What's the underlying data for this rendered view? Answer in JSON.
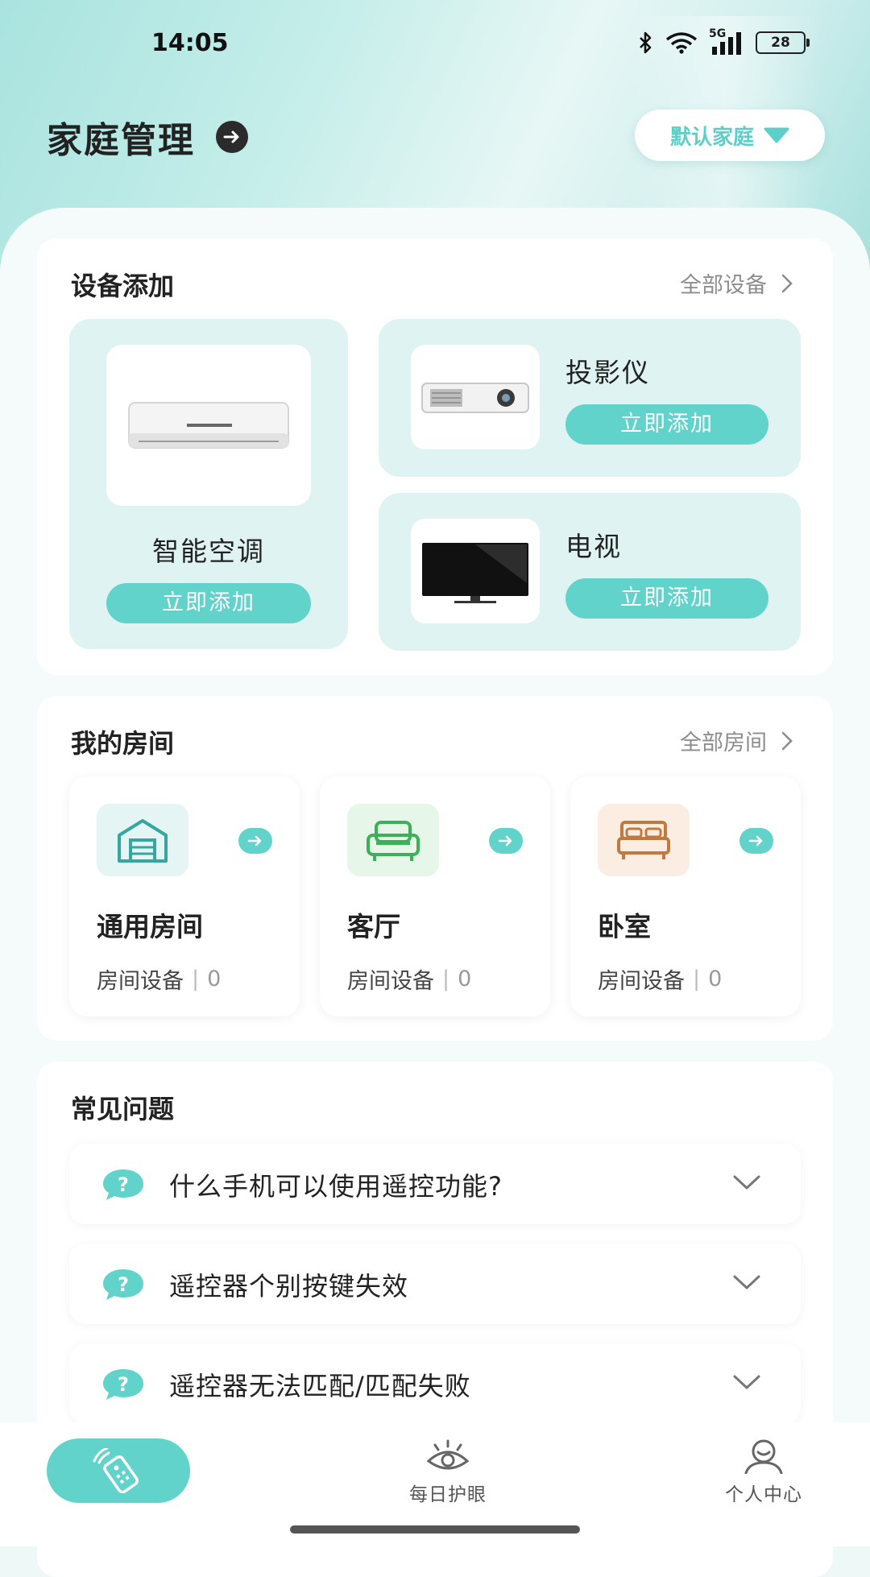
{
  "status_bar": {
    "time": "14:05",
    "network": "5G",
    "battery": "28"
  },
  "header": {
    "title": "家庭管理",
    "family_selector": "默认家庭"
  },
  "devices": {
    "title": "设备添加",
    "all_link": "全部设备",
    "items": [
      {
        "name": "智能空调",
        "action": "立即添加",
        "icon": "air-conditioner-image"
      },
      {
        "name": "投影仪",
        "action": "立即添加",
        "icon": "projector-image"
      },
      {
        "name": "电视",
        "action": "立即添加",
        "icon": "tv-image"
      }
    ]
  },
  "rooms": {
    "title": "我的房间",
    "all_link": "全部房间",
    "items": [
      {
        "name": "通用房间",
        "devices_label": "房间设备",
        "count": "0",
        "icon": "house-icon",
        "icon_bg": "#e4f5f4",
        "icon_color": "#35a6a0"
      },
      {
        "name": "客厅",
        "devices_label": "房间设备",
        "count": "0",
        "icon": "sofa-icon",
        "icon_bg": "#e6f6e8",
        "icon_color": "#3bb056"
      },
      {
        "name": "卧室",
        "devices_label": "房间设备",
        "count": "0",
        "icon": "bed-icon",
        "icon_bg": "#fbede2",
        "icon_color": "#c0793f"
      }
    ]
  },
  "faq": {
    "title": "常见问题",
    "items": [
      {
        "question": "什么手机可以使用遥控功能?"
      },
      {
        "question": "遥控器个别按键失效"
      },
      {
        "question": "遥控器无法匹配/匹配失败"
      }
    ]
  },
  "tabbar": {
    "items": [
      {
        "label": "",
        "icon": "remote-control-icon",
        "active": true
      },
      {
        "label": "每日护眼",
        "icon": "eye-icon",
        "active": false
      },
      {
        "label": "个人中心",
        "icon": "user-icon",
        "active": false
      }
    ]
  },
  "colors": {
    "accent": "#62d3cb",
    "card_tint": "#dff4f2"
  }
}
